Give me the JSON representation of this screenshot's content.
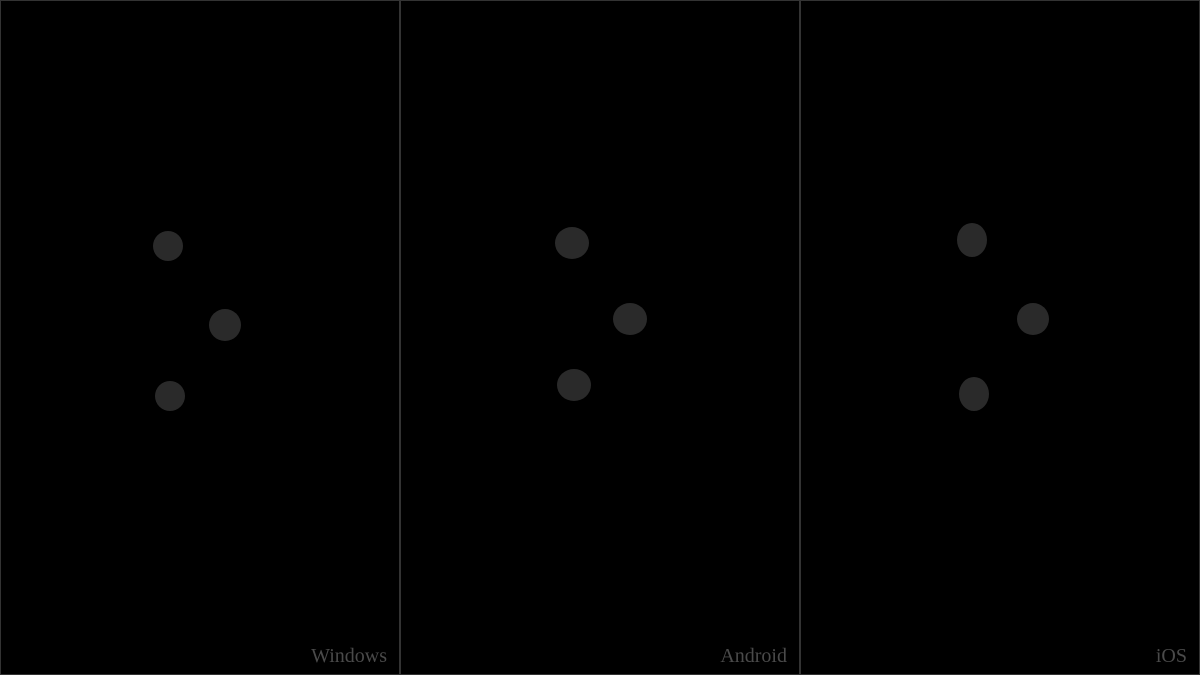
{
  "panels": [
    {
      "platform": "Windows"
    },
    {
      "platform": "Android"
    },
    {
      "platform": "iOS"
    }
  ]
}
